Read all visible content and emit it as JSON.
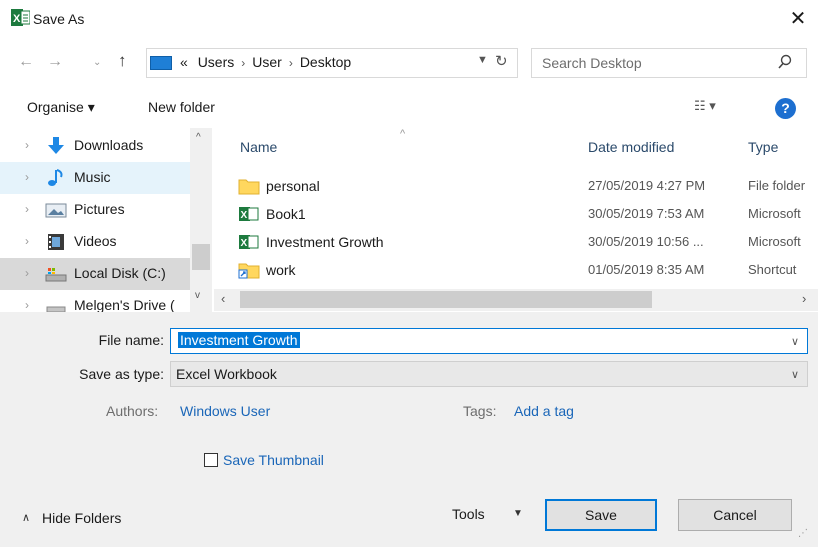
{
  "window": {
    "title": "Save As",
    "close_icon": "close-icon",
    "app_icon": "excel-icon"
  },
  "address": {
    "segments": [
      "Users",
      "User",
      "Desktop"
    ],
    "overflow": "«",
    "search_placeholder": "Search Desktop"
  },
  "toolbar": {
    "organise": "Organise ▾",
    "new_folder": "New folder",
    "help": "?"
  },
  "nav": {
    "items": [
      {
        "label": "Downloads",
        "icon": "download-icon"
      },
      {
        "label": "Music",
        "icon": "music-icon"
      },
      {
        "label": "Pictures",
        "icon": "pictures-icon"
      },
      {
        "label": "Videos",
        "icon": "videos-icon"
      },
      {
        "label": "Local Disk (C:)",
        "icon": "disk-icon"
      },
      {
        "label": "Melgen's Drive (",
        "icon": "drive-icon"
      }
    ]
  },
  "files": {
    "columns": {
      "name": "Name",
      "date": "Date modified",
      "type": "Type"
    },
    "rows": [
      {
        "name": "personal",
        "date": "27/05/2019 4:27 PM",
        "type": "File folder",
        "icon": "folder-icon"
      },
      {
        "name": "Book1",
        "date": "30/05/2019 7:53 AM",
        "type": "Microsoft",
        "icon": "excel-file-icon"
      },
      {
        "name": "Investment Growth",
        "date": "30/05/2019 10:56 ...",
        "type": "Microsoft",
        "icon": "excel-file-icon"
      },
      {
        "name": "work",
        "date": "01/05/2019 8:35 AM",
        "type": "Shortcut",
        "icon": "shortcut-icon"
      }
    ]
  },
  "form": {
    "file_name_label": "File name:",
    "file_name_value": "Investment Growth",
    "save_type_label": "Save as type:",
    "save_type_value": "Excel Workbook",
    "authors_label": "Authors:",
    "authors_value": "Windows User",
    "tags_label": "Tags:",
    "tags_value": "Add a tag",
    "thumbnail_label": "Save Thumbnail"
  },
  "footer": {
    "hide_folders": "Hide Folders",
    "tools": "Tools",
    "save": "Save",
    "cancel": "Cancel"
  },
  "colors": {
    "accent": "#0078d7",
    "link": "#1a66b8",
    "panel": "#f0f0f0"
  }
}
